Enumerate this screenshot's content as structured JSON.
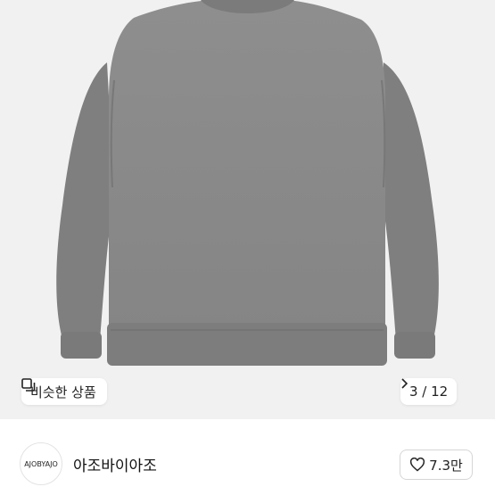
{
  "product_image": {
    "subject": "gray sweatshirt",
    "color": "#8a8a8a"
  },
  "similar_button": {
    "label": "비슷한 상품",
    "icon": "similar-items-icon"
  },
  "image_counter": {
    "text": "3 / 12",
    "icon": "chevron-right-icon"
  },
  "seller": {
    "avatar_text": "AJOBYAJO",
    "name": "아조바이아조"
  },
  "like_button": {
    "count": "7.3만",
    "icon": "heart-outline-icon"
  },
  "colors": {
    "background": "#ffffff",
    "photo_bg": "#f1f1f1",
    "border": "#d6d6d6"
  }
}
